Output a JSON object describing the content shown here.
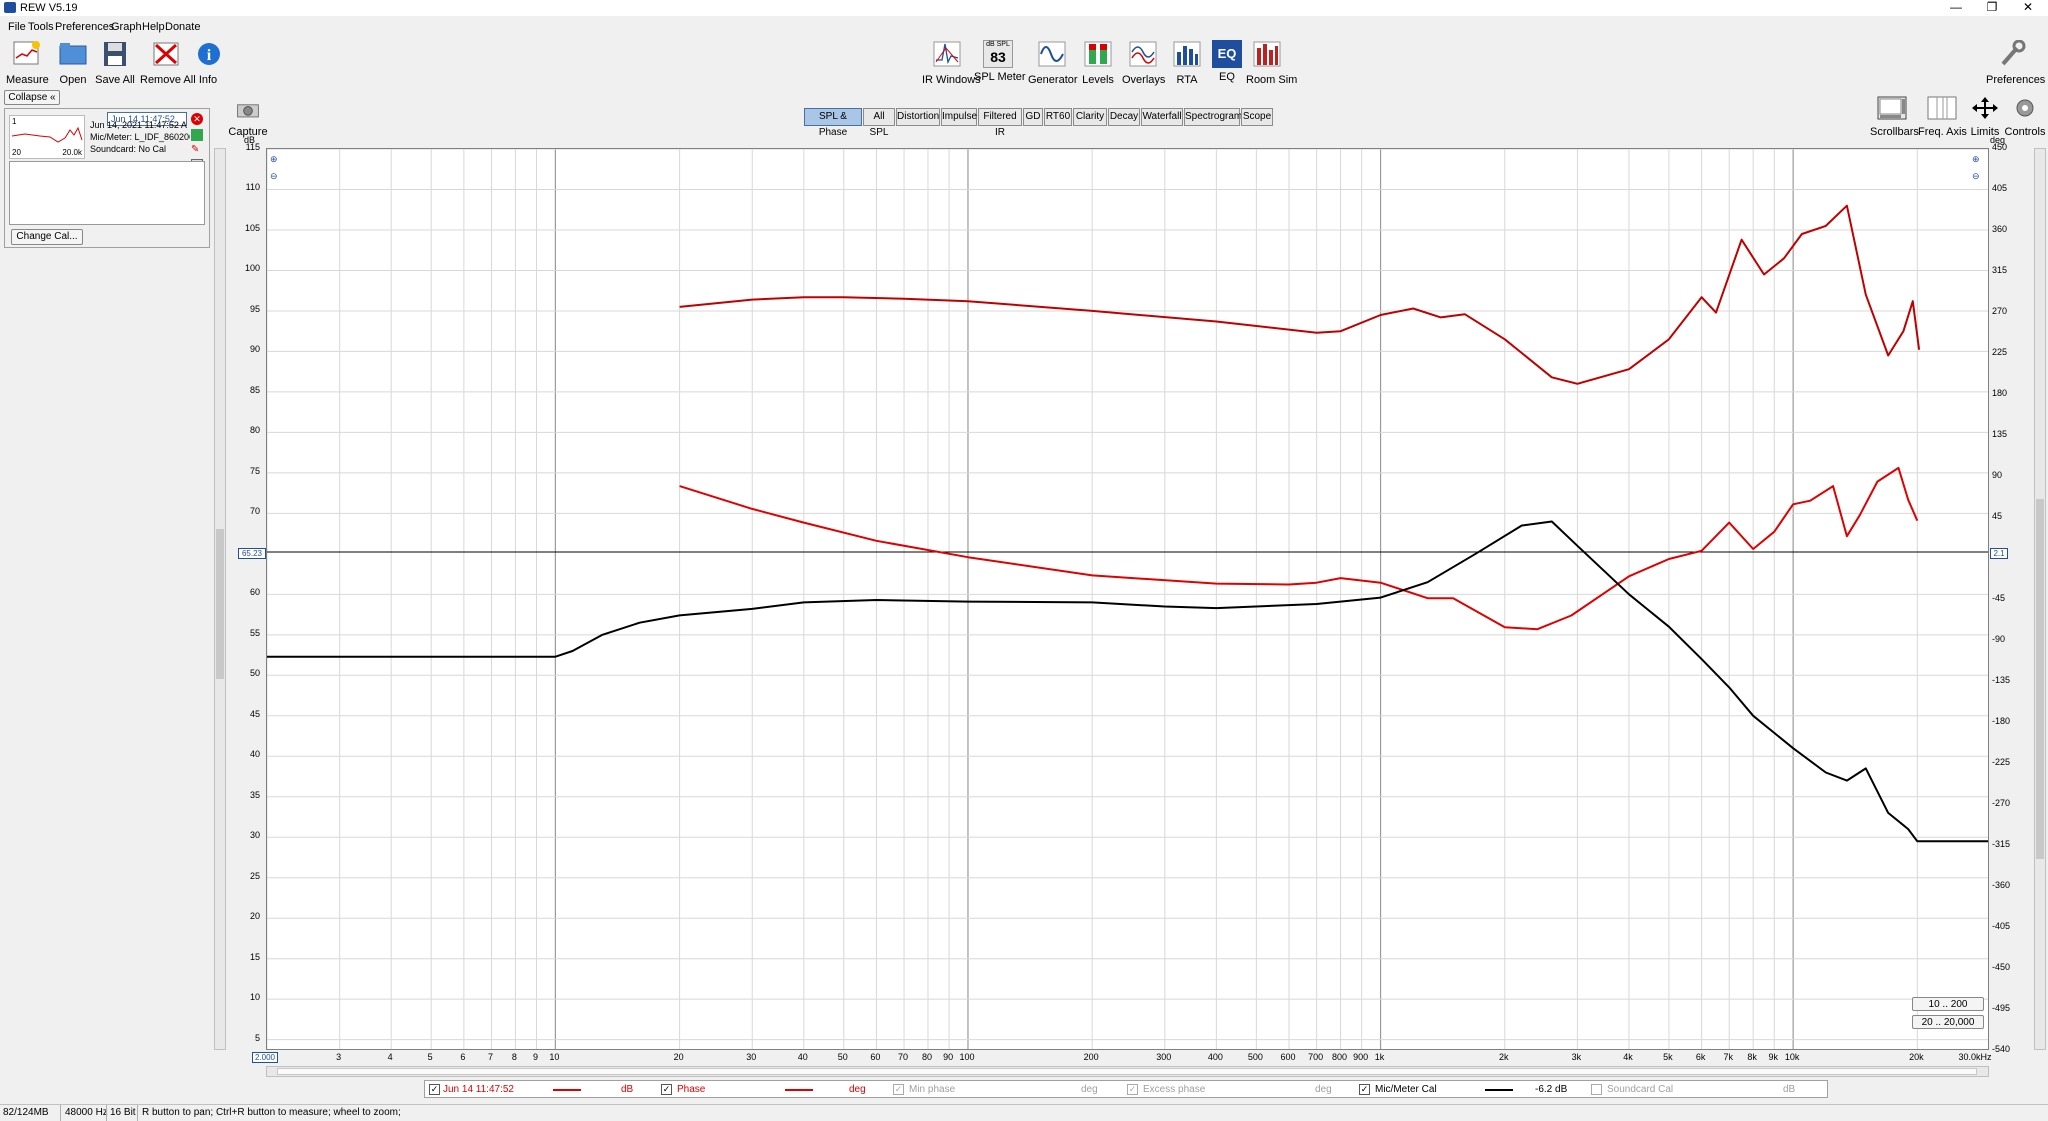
{
  "window": {
    "title": "REW V5.19"
  },
  "menu": [
    "File",
    "Tools",
    "Preferences",
    "Graph",
    "Help",
    "Donate"
  ],
  "toolbar_left": [
    {
      "label": "Measure",
      "icon": "measure-icon"
    },
    {
      "label": "Open",
      "icon": "folder-open-icon"
    },
    {
      "label": "Save All",
      "icon": "save-icon"
    },
    {
      "label": "Remove All",
      "icon": "remove-all-icon"
    },
    {
      "label": "Info",
      "icon": "info-icon"
    }
  ],
  "toolbar_center": [
    {
      "label": "IR Windows",
      "icon": "ir-windows-icon"
    },
    {
      "label": "SPL Meter",
      "icon": "spl-meter-icon",
      "badge_top": "dB SPL",
      "badge_value": "83"
    },
    {
      "label": "Generator",
      "icon": "generator-icon"
    },
    {
      "label": "Levels",
      "icon": "levels-icon"
    },
    {
      "label": "Overlays",
      "icon": "overlays-icon"
    },
    {
      "label": "RTA",
      "icon": "rta-icon"
    },
    {
      "label": "EQ",
      "icon": "eq-icon"
    },
    {
      "label": "Room Sim",
      "icon": "room-sim-icon"
    }
  ],
  "toolbar_right": {
    "label": "Preferences",
    "icon": "wrench-icon"
  },
  "graph_controls": [
    {
      "label": "Scrollbars",
      "icon": "scrollbars-icon"
    },
    {
      "label": "Freq. Axis",
      "icon": "freq-axis-icon"
    },
    {
      "label": "Limits",
      "icon": "limits-icon"
    },
    {
      "label": "Controls",
      "icon": "controls-gear-icon"
    }
  ],
  "capture": {
    "label": "Capture"
  },
  "tabs": [
    {
      "label": "SPL & Phase",
      "selected": true
    },
    {
      "label": "All SPL"
    },
    {
      "label": "Distortion"
    },
    {
      "label": "Impulse"
    },
    {
      "label": "Filtered IR"
    },
    {
      "label": "GD"
    },
    {
      "label": "RT60"
    },
    {
      "label": "Clarity"
    },
    {
      "label": "Decay"
    },
    {
      "label": "Waterfall"
    },
    {
      "label": "Spectrogram"
    },
    {
      "label": "Scope"
    }
  ],
  "left_panel": {
    "collapse_label": "Collapse",
    "measurement_name": "Jun 14 11:47:52",
    "index": "1",
    "thumb_left": "20",
    "thumb_right": "20.0k",
    "details": [
      "Jun 14, 2021 11:47:52 A",
      "Mic/Meter: L_IDF_860206",
      "Soundcard: No Cal"
    ],
    "change_cal_label": "Change Cal..."
  },
  "graph": {
    "left_unit": "dB",
    "right_unit": "deg",
    "cursor_left_value": "65.23",
    "cursor_right_value": "2.1",
    "x_start_box": "2.000",
    "range_buttons": [
      "10 .. 200",
      "20 .. 20,000"
    ]
  },
  "legend": [
    {
      "checked": true,
      "name": "Jun 14 11:47:52",
      "unit": "dB",
      "color": "#e00000",
      "enabled": true
    },
    {
      "checked": true,
      "name": "Phase",
      "unit": "deg",
      "color": "#e00000",
      "enabled": true
    },
    {
      "checked": true,
      "name": "Min phase",
      "unit": "deg",
      "color": "#a0a0a0",
      "enabled": false
    },
    {
      "checked": true,
      "name": "Excess phase",
      "unit": "deg",
      "color": "#a0a0a0",
      "enabled": false
    },
    {
      "checked": true,
      "name": "Mic/Meter Cal",
      "unit": "-6.2 dB",
      "color": "#000000",
      "enabled": true
    },
    {
      "checked": false,
      "name": "Soundcard Cal",
      "unit": "dB",
      "color": "#a0a0a0",
      "enabled": false
    }
  ],
  "status": {
    "memory": "82/124MB",
    "sample_rate": "48000 Hz",
    "bit_depth": "16 Bit",
    "hint": "R button to pan; Ctrl+R button to measure; wheel to zoom;"
  },
  "chart_data": {
    "type": "line",
    "x_scale": "log",
    "xlim": [
      2,
      30000
    ],
    "x_ticks": [
      {
        "v": 3,
        "t": "3"
      },
      {
        "v": 4,
        "t": "4"
      },
      {
        "v": 5,
        "t": "5"
      },
      {
        "v": 6,
        "t": "6"
      },
      {
        "v": 7,
        "t": "7"
      },
      {
        "v": 8,
        "t": "8"
      },
      {
        "v": 9,
        "t": "9"
      },
      {
        "v": 10,
        "t": "10"
      },
      {
        "v": 20,
        "t": "20"
      },
      {
        "v": 30,
        "t": "30"
      },
      {
        "v": 40,
        "t": "40"
      },
      {
        "v": 50,
        "t": "50"
      },
      {
        "v": 60,
        "t": "60"
      },
      {
        "v": 70,
        "t": "70"
      },
      {
        "v": 80,
        "t": "80"
      },
      {
        "v": 90,
        "t": "90"
      },
      {
        "v": 100,
        "t": "100"
      },
      {
        "v": 200,
        "t": "200"
      },
      {
        "v": 300,
        "t": "300"
      },
      {
        "v": 400,
        "t": "400"
      },
      {
        "v": 500,
        "t": "500"
      },
      {
        "v": 600,
        "t": "600"
      },
      {
        "v": 700,
        "t": "700"
      },
      {
        "v": 800,
        "t": "800"
      },
      {
        "v": 900,
        "t": "900"
      },
      {
        "v": 1000,
        "t": "1k"
      },
      {
        "v": 2000,
        "t": "2k"
      },
      {
        "v": 3000,
        "t": "3k"
      },
      {
        "v": 4000,
        "t": "4k"
      },
      {
        "v": 5000,
        "t": "5k"
      },
      {
        "v": 6000,
        "t": "6k"
      },
      {
        "v": 7000,
        "t": "7k"
      },
      {
        "v": 8000,
        "t": "8k"
      },
      {
        "v": 9000,
        "t": "9k"
      },
      {
        "v": 10000,
        "t": "10k"
      },
      {
        "v": 20000,
        "t": "20k"
      },
      {
        "v": 30000,
        "t": "30.0kHz"
      }
    ],
    "y_left": {
      "label": "dB",
      "lim": [
        3.6,
        115
      ],
      "ticks": [
        115,
        110,
        105,
        100,
        95,
        90,
        85,
        80,
        75,
        70,
        60,
        55,
        50,
        45,
        40,
        35,
        30,
        25,
        20,
        15,
        10,
        5
      ]
    },
    "y_right": {
      "label": "deg",
      "lim": [
        -540,
        450
      ],
      "ticks": [
        450,
        405,
        360,
        315,
        270,
        225,
        180,
        135,
        90,
        45,
        -45,
        -90,
        -135,
        -180,
        -225,
        -270,
        -315,
        -360,
        -405,
        -450,
        -495,
        -540
      ]
    },
    "cursor": {
      "y_db": 65.23
    },
    "series": [
      {
        "name": "Jun 14 11:47:52",
        "axis": "left",
        "color": "#c00000",
        "x": [
          20,
          30,
          40,
          50,
          70,
          100,
          200,
          400,
          700,
          800,
          1000,
          1200,
          1400,
          1600,
          2000,
          2600,
          3000,
          4000,
          5000,
          6000,
          6500,
          7500,
          8500,
          9500,
          10500,
          12000,
          13500,
          15000,
          17000,
          18500,
          19500,
          20200
        ],
        "y": [
          95.5,
          96.4,
          96.7,
          96.7,
          96.5,
          96.2,
          95.0,
          93.7,
          92.3,
          92.5,
          94.5,
          95.3,
          94.2,
          94.6,
          91.5,
          86.8,
          86.0,
          87.8,
          91.5,
          96.7,
          94.8,
          103.8,
          99.5,
          101.5,
          104.5,
          105.5,
          108.0,
          97.0,
          89.5,
          92.5,
          96.2,
          90.2
        ]
      },
      {
        "name": "Phase",
        "axis": "right",
        "color": "#e00000",
        "x": [
          20,
          30,
          40,
          60,
          100,
          200,
          400,
          600,
          700,
          800,
          1000,
          1300,
          1500,
          2000,
          2400,
          2900,
          4000,
          5000,
          6000,
          7000,
          8000,
          9000,
          10000,
          11000,
          12500,
          13500,
          14500,
          16000,
          18000,
          19000,
          20000
        ],
        "y": [
          80,
          55,
          40,
          20,
          2,
          -18,
          -27,
          -28,
          -26,
          -21,
          -26,
          -43,
          -43,
          -75,
          -77,
          -62,
          -19,
          0,
          9,
          40,
          11,
          30,
          60,
          64,
          80,
          25,
          48,
          85,
          100,
          65,
          42
        ]
      },
      {
        "name": "Mic/Meter Cal",
        "axis": "left",
        "color": "#000000",
        "x": [
          2,
          10,
          11,
          13,
          16,
          20,
          30,
          40,
          60,
          100,
          200,
          300,
          400,
          700,
          1000,
          1300,
          1700,
          2200,
          2600,
          3000,
          4000,
          5000,
          6000,
          7000,
          8000,
          10000,
          12000,
          13500,
          15000,
          17000,
          19000,
          20000,
          30000
        ],
        "y": [
          52.3,
          52.3,
          53.0,
          55.0,
          56.5,
          57.4,
          58.2,
          59.0,
          59.3,
          59.1,
          59.0,
          58.5,
          58.3,
          58.8,
          59.6,
          61.5,
          65.0,
          68.5,
          69.0,
          66.0,
          60.0,
          56.0,
          52.0,
          48.5,
          45.0,
          41.0,
          38.0,
          37.0,
          38.5,
          33.0,
          31.0,
          29.5,
          29.5
        ]
      }
    ]
  }
}
